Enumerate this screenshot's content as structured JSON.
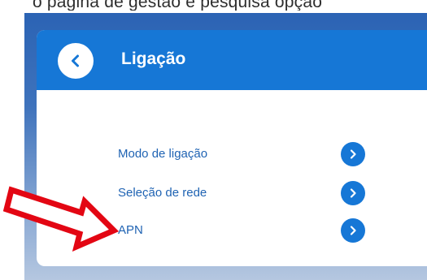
{
  "top_text": "o página de gestão e pesquisa opção",
  "header": {
    "title": "Ligação",
    "back_icon": "chevron-left-icon"
  },
  "menu": {
    "items": [
      {
        "label": "Modo de ligação",
        "icon": "chevron-right-icon"
      },
      {
        "label": "Seleção de rede",
        "icon": "chevron-right-icon"
      },
      {
        "label": "APN",
        "icon": "chevron-right-icon"
      }
    ]
  },
  "annotation": {
    "icon": "red-arrow-icon",
    "target": "APN"
  },
  "colors": {
    "accent": "#1677d6",
    "link": "#1f63b3",
    "annotation_red": "#e30613"
  }
}
